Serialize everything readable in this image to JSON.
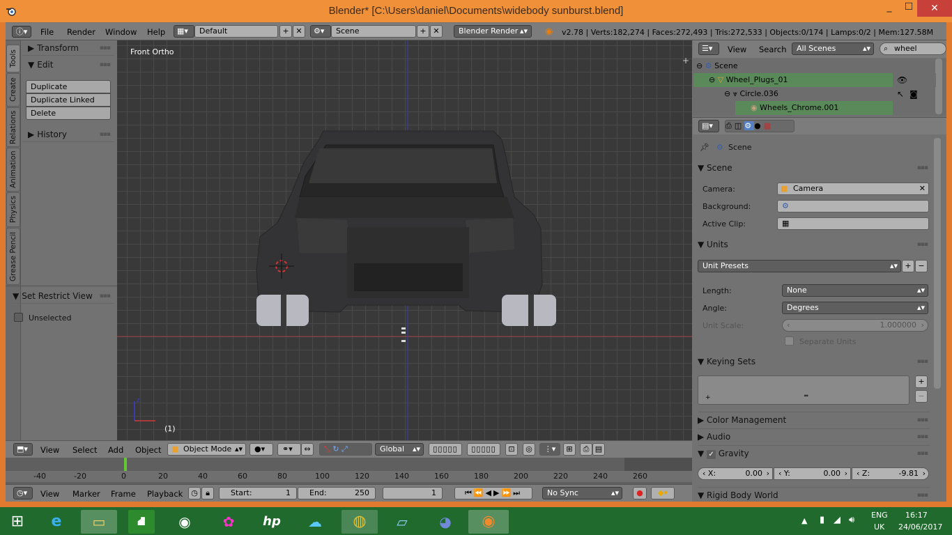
{
  "window": {
    "title": "Blender* [C:\\Users\\daniel\\Documents\\widebody sunburst.blend]",
    "minimize": "_",
    "maximize": "☐",
    "close": "✕"
  },
  "info_header": {
    "menus": [
      "File",
      "Render",
      "Window",
      "Help"
    ],
    "layout": "Default",
    "scene": "Scene",
    "engine": "Blender Render",
    "stats": "v2.78 | Verts:182,274 | Faces:272,493 | Tris:272,533 | Objects:0/174 | Lamps:0/2 | Mem:127.58M"
  },
  "tool_tabs": [
    "Tools",
    "Create",
    "Relations",
    "Animation",
    "Physics",
    "Grease Pencil"
  ],
  "toolshelf": {
    "transform": "Transform",
    "edit": "Edit",
    "buttons": [
      "Duplicate",
      "Duplicate Linked",
      "Delete"
    ],
    "history": "History",
    "restrict": "Set Restrict View",
    "unselected": "Unselected"
  },
  "viewport": {
    "view_label": "Front Ortho",
    "frame_label": "(1)"
  },
  "view3d_header": {
    "menus": [
      "View",
      "Select",
      "Add",
      "Object"
    ],
    "mode": "Object Mode",
    "orientation": "Global"
  },
  "timeline": {
    "ticks": [
      "-40",
      "-20",
      "0",
      "20",
      "40",
      "60",
      "80",
      "100",
      "120",
      "140",
      "160",
      "180",
      "200",
      "220",
      "240",
      "260"
    ],
    "menus": [
      "View",
      "Marker",
      "Frame",
      "Playback"
    ],
    "start_label": "Start:",
    "start": "1",
    "end_label": "End:",
    "end": "250",
    "current": "1",
    "sync": "No Sync"
  },
  "outliner": {
    "menus": [
      "View",
      "Search"
    ],
    "filter": "All Scenes",
    "search": "wheel",
    "rows": [
      "Scene",
      "Wheel_Plugs_01",
      "Circle.036",
      "Wheels_Chrome.001"
    ]
  },
  "properties": {
    "context": "Scene",
    "scene_panel": "Scene",
    "camera_label": "Camera:",
    "camera": "Camera",
    "background_label": "Background:",
    "clip_label": "Active Clip:",
    "units_panel": "Units",
    "unit_presets": "Unit Presets",
    "length_label": "Length:",
    "length": "None",
    "angle_label": "Angle:",
    "angle": "Degrees",
    "unit_scale_label": "Unit Scale:",
    "unit_scale": "1.000000",
    "separate_units": "Separate Units",
    "keying_panel": "Keying Sets",
    "color_mgmt": "Color Management",
    "audio": "Audio",
    "gravity": "Gravity",
    "gx_label": "X:",
    "gx": "0.00",
    "gy_label": "Y:",
    "gy": "0.00",
    "gz_label": "Z:",
    "gz": "-9.81",
    "rigid": "Rigid Body World"
  },
  "taskbar": {
    "lang": "ENG",
    "region": "UK",
    "time": "16:17",
    "date": "24/06/2017"
  },
  "colors": {
    "titlebar": "#f0913a",
    "taskbar": "#1f6a2c",
    "viewport_bg": "#393939",
    "selected_row": "#5a8a5a"
  }
}
